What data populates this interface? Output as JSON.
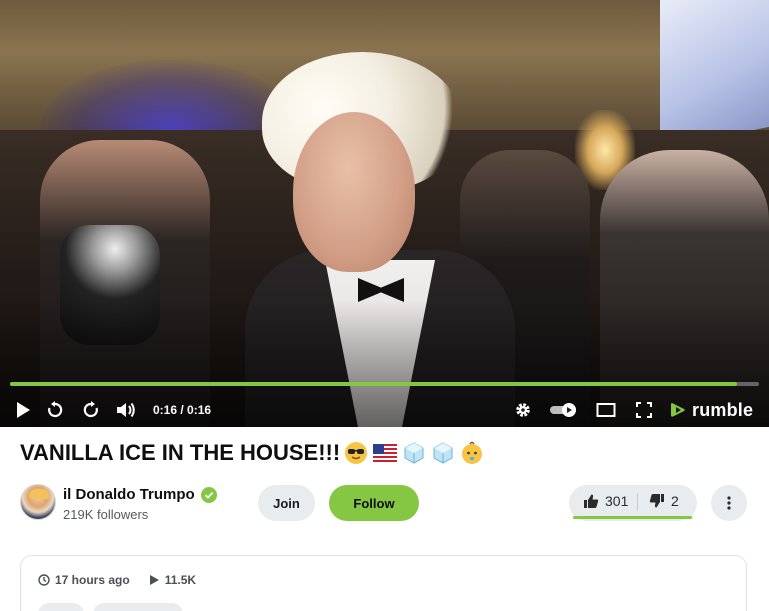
{
  "player": {
    "time_current": "0:16",
    "time_total": "0:16",
    "time_readout": "0:16 / 0:16",
    "progress_fraction": 0.97,
    "brand": "rumble",
    "accent_color": "#85c742",
    "controls": [
      "play-icon",
      "replay-back-icon",
      "forward-icon",
      "volume-icon",
      "settings-gear-icon",
      "autoplay-toggle",
      "theater-mode-icon",
      "fullscreen-icon"
    ]
  },
  "video": {
    "title": "VANILLA ICE IN THE HOUSE!!!",
    "title_emojis": [
      "sunglasses-face-emoji",
      "us-flag-emoji",
      "ice-cube-emoji",
      "ice-cube-emoji",
      "baby-face-emoji"
    ]
  },
  "channel": {
    "name": "il Donaldo Trumpo",
    "verified": true,
    "followers": "219K followers"
  },
  "actions": {
    "join_label": "Join",
    "follow_label": "Follow",
    "upvotes": "301",
    "downvotes": "2",
    "upvote_fraction": 0.99
  },
  "info": {
    "posted": "17 hours ago",
    "views": "11.5K"
  }
}
